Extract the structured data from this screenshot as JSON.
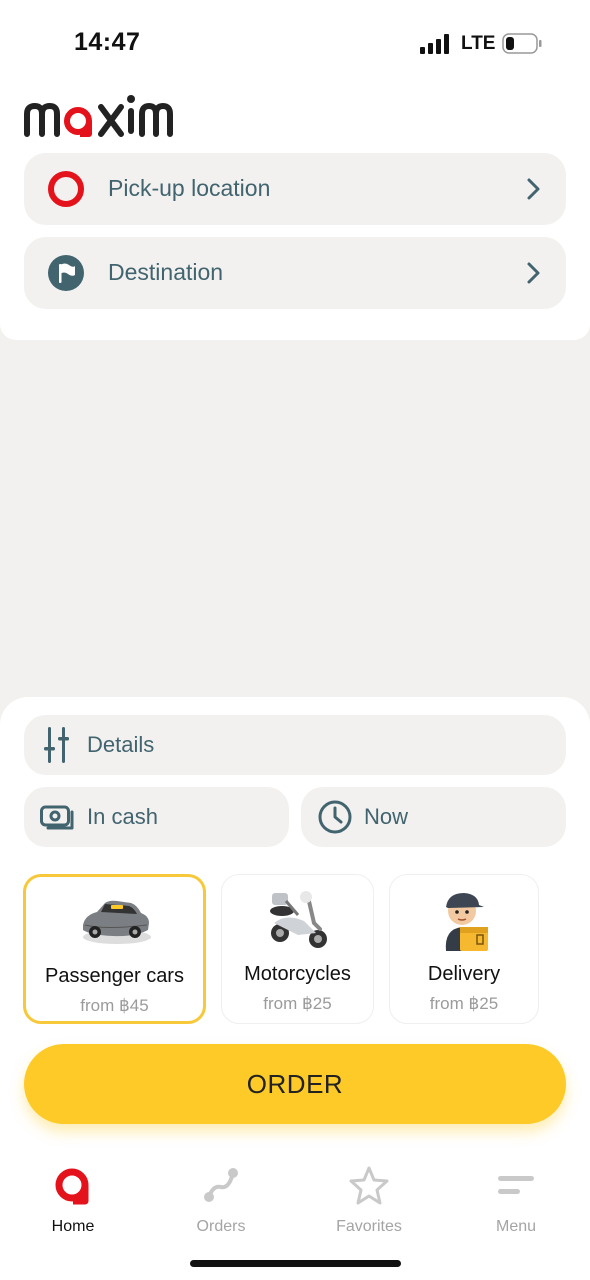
{
  "status": {
    "time": "14:47",
    "network": "LTE"
  },
  "brand": {
    "name": "maxim",
    "accent": "#e4121b",
    "yellow": "#fdca27"
  },
  "route": {
    "pickup_label": "Pick-up location",
    "destination_label": "Destination"
  },
  "options": {
    "details_label": "Details",
    "payment_label": "In cash",
    "time_label": "Now"
  },
  "services": [
    {
      "title": "Passenger cars",
      "price": "from ฿45",
      "icon": "car-icon",
      "selected": true
    },
    {
      "title": "Motorcycles",
      "price": "from ฿25",
      "icon": "motorcycle-icon",
      "selected": false
    },
    {
      "title": "Delivery",
      "price": "from ฿25",
      "icon": "courier-icon",
      "selected": false
    }
  ],
  "order_button": "ORDER",
  "tabs": [
    {
      "label": "Home",
      "icon": "home-icon",
      "active": true
    },
    {
      "label": "Orders",
      "icon": "route-icon",
      "active": false
    },
    {
      "label": "Favorites",
      "icon": "star-icon",
      "active": false
    },
    {
      "label": "Menu",
      "icon": "menu-icon",
      "active": false
    }
  ]
}
